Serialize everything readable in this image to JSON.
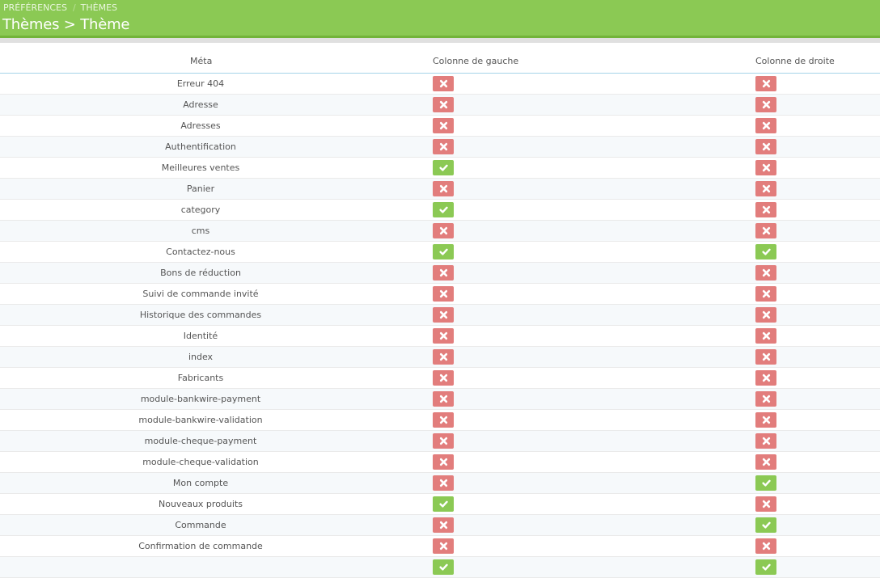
{
  "breadcrumb": {
    "items": [
      "PRÉFÉRENCES",
      "THÈMES"
    ],
    "separator": "/"
  },
  "title": "Thèmes > Thème",
  "colors": {
    "header": "#8bc954",
    "yes": "#8bc954",
    "no": "#e27d7c"
  },
  "table": {
    "columns": [
      "Méta",
      "Colonne de gauche",
      "Colonne de droite"
    ],
    "rows": [
      {
        "meta": "Erreur 404",
        "left": false,
        "right": false
      },
      {
        "meta": "Adresse",
        "left": false,
        "right": false
      },
      {
        "meta": "Adresses",
        "left": false,
        "right": false
      },
      {
        "meta": "Authentification",
        "left": false,
        "right": false
      },
      {
        "meta": "Meilleures ventes",
        "left": true,
        "right": false
      },
      {
        "meta": "Panier",
        "left": false,
        "right": false
      },
      {
        "meta": "category",
        "left": true,
        "right": false
      },
      {
        "meta": "cms",
        "left": false,
        "right": false
      },
      {
        "meta": "Contactez-nous",
        "left": true,
        "right": true
      },
      {
        "meta": "Bons de réduction",
        "left": false,
        "right": false
      },
      {
        "meta": "Suivi de commande invité",
        "left": false,
        "right": false
      },
      {
        "meta": "Historique des commandes",
        "left": false,
        "right": false
      },
      {
        "meta": "Identité",
        "left": false,
        "right": false
      },
      {
        "meta": "index",
        "left": false,
        "right": false
      },
      {
        "meta": "Fabricants",
        "left": false,
        "right": false
      },
      {
        "meta": "module-bankwire-payment",
        "left": false,
        "right": false
      },
      {
        "meta": "module-bankwire-validation",
        "left": false,
        "right": false
      },
      {
        "meta": "module-cheque-payment",
        "left": false,
        "right": false
      },
      {
        "meta": "module-cheque-validation",
        "left": false,
        "right": false
      },
      {
        "meta": "Mon compte",
        "left": false,
        "right": true
      },
      {
        "meta": "Nouveaux produits",
        "left": true,
        "right": false
      },
      {
        "meta": "Commande",
        "left": false,
        "right": true
      },
      {
        "meta": "Confirmation de commande",
        "left": false,
        "right": false
      },
      {
        "meta": "",
        "left": true,
        "right": true
      }
    ]
  }
}
